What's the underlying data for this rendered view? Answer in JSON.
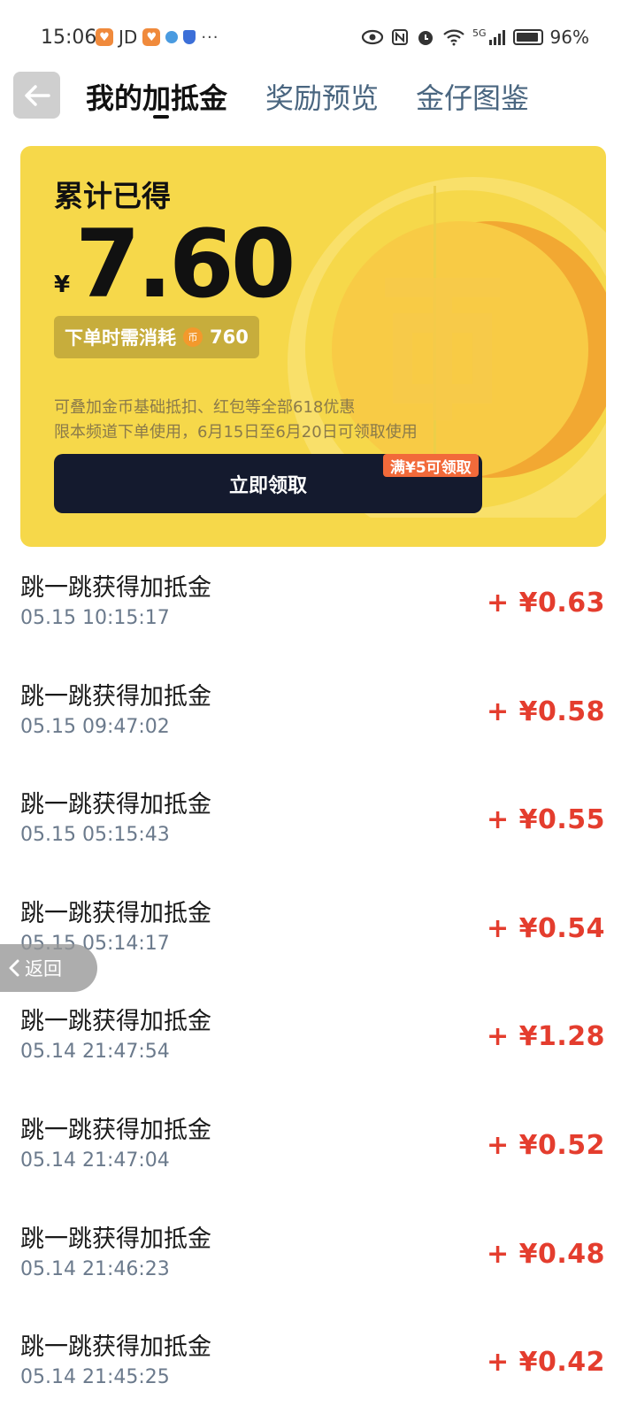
{
  "status_bar": {
    "time": "15:06",
    "carrier_text": "JD",
    "more": "···",
    "battery": "96%",
    "network": "5G",
    "icons": [
      "eye-icon",
      "nfc-icon",
      "alarm-icon",
      "wifi-icon",
      "signal-icon",
      "battery-icon"
    ]
  },
  "header": {
    "tabs": [
      {
        "label": "我的加抵金",
        "active": true
      },
      {
        "label": "奖励预览",
        "active": false
      },
      {
        "label": "金仔图鉴",
        "active": false
      }
    ]
  },
  "card": {
    "title": "累计已得",
    "currency": "¥",
    "amount": "7.60",
    "consume_label": "下单时需消耗",
    "coin_symbol": "币",
    "consume_value": "760",
    "note_line1": "可叠加金币基础抵扣、红包等全部618优惠",
    "note_line2": "限本频道下单使用，6月15日至6月20日可领取使用",
    "claim_button": "立即领取",
    "claim_tag": "满¥5可领取"
  },
  "records": [
    {
      "title": "跳一跳获得加抵金",
      "time": "05.15 10:15:17",
      "amount": "+ ¥0.63"
    },
    {
      "title": "跳一跳获得加抵金",
      "time": "05.15 09:47:02",
      "amount": "+ ¥0.58"
    },
    {
      "title": "跳一跳获得加抵金",
      "time": "05.15 05:15:43",
      "amount": "+ ¥0.55"
    },
    {
      "title": "跳一跳获得加抵金",
      "time": "05.15 05:14:17",
      "amount": "+ ¥0.54"
    },
    {
      "title": "跳一跳获得加抵金",
      "time": "05.14 21:47:54",
      "amount": "+ ¥1.28"
    },
    {
      "title": "跳一跳获得加抵金",
      "time": "05.14 21:47:04",
      "amount": "+ ¥0.52"
    },
    {
      "title": "跳一跳获得加抵金",
      "time": "05.14 21:46:23",
      "amount": "+ ¥0.48"
    },
    {
      "title": "跳一跳获得加抵金",
      "time": "05.14 21:45:25",
      "amount": "+ ¥0.42"
    }
  ],
  "float_back": {
    "label": "返回"
  },
  "colors": {
    "card_bg": "#f6d84a",
    "button_dark": "#141a2e",
    "amount_red": "#e43d2e",
    "tag_orange": "#f26a3a"
  }
}
